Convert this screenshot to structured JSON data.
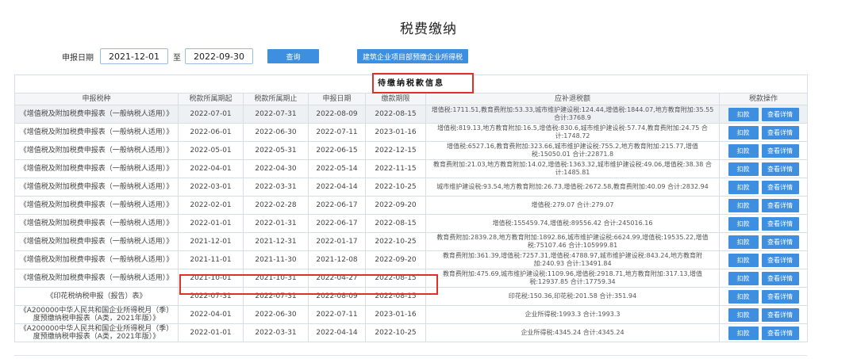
{
  "page": {
    "title": "税费缴纳"
  },
  "filter": {
    "date_label": "申报日期",
    "start_date": "2021-12-01",
    "to_label": "至",
    "end_date": "2022-09-30",
    "query_button": "查询",
    "corp_button": "建筑企业项目部预缴企业所得税"
  },
  "table": {
    "caption": "待缴纳税款信息",
    "columns": [
      "申报税种",
      "税款所属期起",
      "税款所属期止",
      "申报日期",
      "缴款期限",
      "应补退税额",
      "税款操作"
    ],
    "deduct_label": "扣款",
    "detail_label": "查看详情",
    "rows": [
      {
        "name": "《增值税及附加税费申报表（一般纳税人适用）》",
        "start": "2022-07-01",
        "end": "2022-07-31",
        "declare": "2022-08-09",
        "deadline": "2022-08-15",
        "amount": "增值税:1711.51,教育费附加:53.33,城市维护建设税:124.44,增值税:1844.07,地方教育附加:35.55 合计:3768.9"
      },
      {
        "name": "《增值税及附加税费申报表（一般纳税人适用）》",
        "start": "2022-06-01",
        "end": "2022-06-30",
        "declare": "2022-07-11",
        "deadline": "2023-01-16",
        "amount": "增值税:819.13,地方教育附加:16.5,增值税:830.6,城市维护建设税:57.74,教育费附加:24.75 合计:1748.72"
      },
      {
        "name": "《增值税及附加税费申报表（一般纳税人适用）》",
        "start": "2022-05-01",
        "end": "2022-05-31",
        "declare": "2022-06-15",
        "deadline": "2022-12-15",
        "amount": "增值税:6527.16,教育费附加:323.66,城市维护建设税:755.2,地方教育附加:215.77,增值税:15050.01 合计:22871.8"
      },
      {
        "name": "《增值税及附加税费申报表（一般纳税人适用）》",
        "start": "2022-04-01",
        "end": "2022-04-30",
        "declare": "2022-05-14",
        "deadline": "2022-11-15",
        "amount": "教育费附加:21.03,地方教育附加:14.02,增值税:1363.32,城市维护建设税:49.06,增值税:38.38 合计:1485.81"
      },
      {
        "name": "《增值税及附加税费申报表（一般纳税人适用）》",
        "start": "2022-03-01",
        "end": "2022-03-31",
        "declare": "2022-04-14",
        "deadline": "2022-10-25",
        "amount": "城市维护建设税:93.54,地方教育附加:26.73,增值税:2672.58,教育费附加:40.09 合计:2832.94"
      },
      {
        "name": "《增值税及附加税费申报表（一般纳税人适用）》",
        "start": "2022-02-01",
        "end": "2022-02-28",
        "declare": "2022-06-17",
        "deadline": "2022-09-20",
        "amount": "增值税:279.07 合计:279.07"
      },
      {
        "name": "《增值税及附加税费申报表（一般纳税人适用）》",
        "start": "2022-01-01",
        "end": "2022-01-31",
        "declare": "2022-06-17",
        "deadline": "2022-08-15",
        "amount": "增值税:155459.74,增值税:89556.42 合计:245016.16"
      },
      {
        "name": "《增值税及附加税费申报表（一般纳税人适用）》",
        "start": "2021-12-01",
        "end": "2021-12-31",
        "declare": "2022-01-17",
        "deadline": "2022-10-25",
        "amount": "教育费附加:2839.28,地方教育附加:1892.86,城市维护建设税:6624.99,增值税:19535.22,增值税:75107.46 合计:105999.81"
      },
      {
        "name": "《增值税及附加税费申报表（一般纳税人适用）》",
        "start": "2021-11-01",
        "end": "2021-11-30",
        "declare": "2021-12-08",
        "deadline": "2022-09-20",
        "amount": "教育费附加:361.39,增值税:7257.31,增值税:4788.97,城市维护建设税:843.24,地方教育附加:240.93 合计:13491.84"
      },
      {
        "name": "《增值税及附加税费申报表（一般纳税人适用）》",
        "start": "2021-10-01",
        "end": "2021-10-31",
        "declare": "2022-04-27",
        "deadline": "2022-08-15",
        "amount": "教育费附加:475.69,城市维护建设税:1109.96,增值税:2918.71,地方教育附加:317.13,增值税:12937.85 合计:17759.34"
      },
      {
        "name": "《印花税纳税申报（报告）表》",
        "start": "2022-07-31",
        "end": "2022-07-31",
        "declare": "2022-08-09",
        "deadline": "2022-08-15",
        "amount": "印花税:150.36,印花税:201.58 合计:351.94"
      },
      {
        "name": "《A200000中华人民共和国企业所得税月（季）度预缴纳税申报表（A类，2021年版）》",
        "start": "2022-04-01",
        "end": "2022-06-30",
        "declare": "2022-07-11",
        "deadline": "2023-01-16",
        "amount": "企业所得税:1993.3 合计:1993.3"
      },
      {
        "name": "《A200000中华人民共和国企业所得税月（季）度预缴纳税申报表（A类，2021年版）》",
        "start": "2022-01-01",
        "end": "2022-03-31",
        "declare": "2022-04-14",
        "deadline": "2022-10-25",
        "amount": "企业所得税:4345.24 合计:4345.24"
      }
    ]
  }
}
